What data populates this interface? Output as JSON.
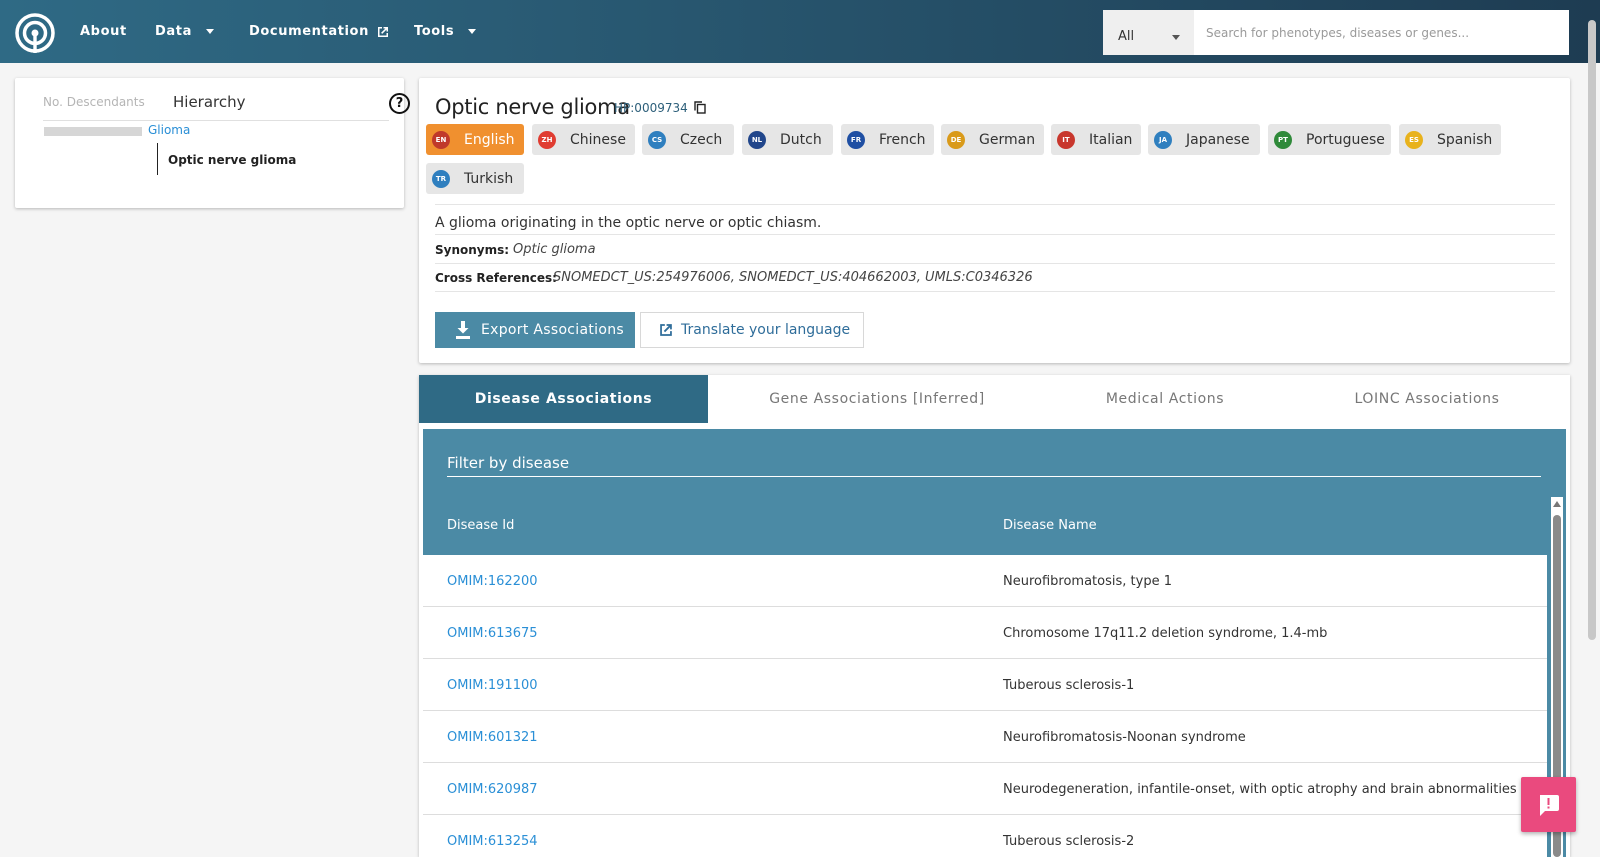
{
  "header": {
    "nav": [
      {
        "label": "About",
        "dropdown": false
      },
      {
        "label": "Data",
        "dropdown": true
      },
      {
        "label": "Documentation",
        "external": true
      },
      {
        "label": "Tools",
        "dropdown": true
      }
    ],
    "search": {
      "category": "All",
      "placeholder": "Search for phenotypes, diseases or genes..."
    }
  },
  "hierarchy": {
    "tab_descendants": "No. Descendants",
    "tab_hierarchy": "Hierarchy",
    "help": "?",
    "parent": "Glioma",
    "current": "Optic nerve glioma"
  },
  "term": {
    "name": "Optic nerve glioma",
    "id": "HP:0009734",
    "languages": [
      {
        "code": "EN",
        "label": "English",
        "color": "#c0392b",
        "active": true
      },
      {
        "code": "ZH",
        "label": "Chinese",
        "color": "#e03c31"
      },
      {
        "code": "CS",
        "label": "Czech",
        "color": "#2f7fbf"
      },
      {
        "code": "NL",
        "label": "Dutch",
        "color": "#21468b"
      },
      {
        "code": "FR",
        "label": "French",
        "color": "#1f4fa3"
      },
      {
        "code": "DE",
        "label": "German",
        "color": "#d99a1a"
      },
      {
        "code": "IT",
        "label": "Italian",
        "color": "#c8372d"
      },
      {
        "code": "JA",
        "label": "Japanese",
        "color": "#2f7fbf"
      },
      {
        "code": "PT",
        "label": "Portuguese",
        "color": "#2f8a3a"
      },
      {
        "code": "ES",
        "label": "Spanish",
        "color": "#e8b21c"
      },
      {
        "code": "TR",
        "label": "Turkish",
        "color": "#2f7fbf"
      }
    ],
    "definition": "A glioma originating in the optic nerve or optic chiasm.",
    "synonyms_label": "Synonyms:",
    "synonyms": "Optic glioma",
    "xrefs_label": "Cross References:",
    "xrefs": "SNOMEDCT_US:254976006, SNOMEDCT_US:404662003, UMLS:C0346326",
    "export_label": "Export Associations",
    "translate_label": "Translate your language"
  },
  "associations": {
    "tabs": [
      "Disease Associations",
      "Gene Associations [Inferred]",
      "Medical Actions",
      "LOINC Associations"
    ],
    "active_tab": 0,
    "filter_placeholder": "Filter by disease",
    "columns": [
      "Disease Id",
      "Disease Name"
    ],
    "rows": [
      {
        "id": "OMIM:162200",
        "name": "Neurofibromatosis, type 1"
      },
      {
        "id": "OMIM:613675",
        "name": "Chromosome 17q11.2 deletion syndrome, 1.4-mb"
      },
      {
        "id": "OMIM:191100",
        "name": "Tuberous sclerosis-1"
      },
      {
        "id": "OMIM:601321",
        "name": "Neurofibromatosis-Noonan syndrome"
      },
      {
        "id": "OMIM:620987",
        "name": "Neurodegeneration, infantile-onset, with optic atrophy and brain abnormalities"
      },
      {
        "id": "OMIM:613254",
        "name": "Tuberous sclerosis-2"
      }
    ]
  },
  "colors": {
    "primary": "#2f6a85",
    "accent": "#f0902f",
    "link": "#2a8fd6",
    "feedback": "#ea4a7e"
  }
}
